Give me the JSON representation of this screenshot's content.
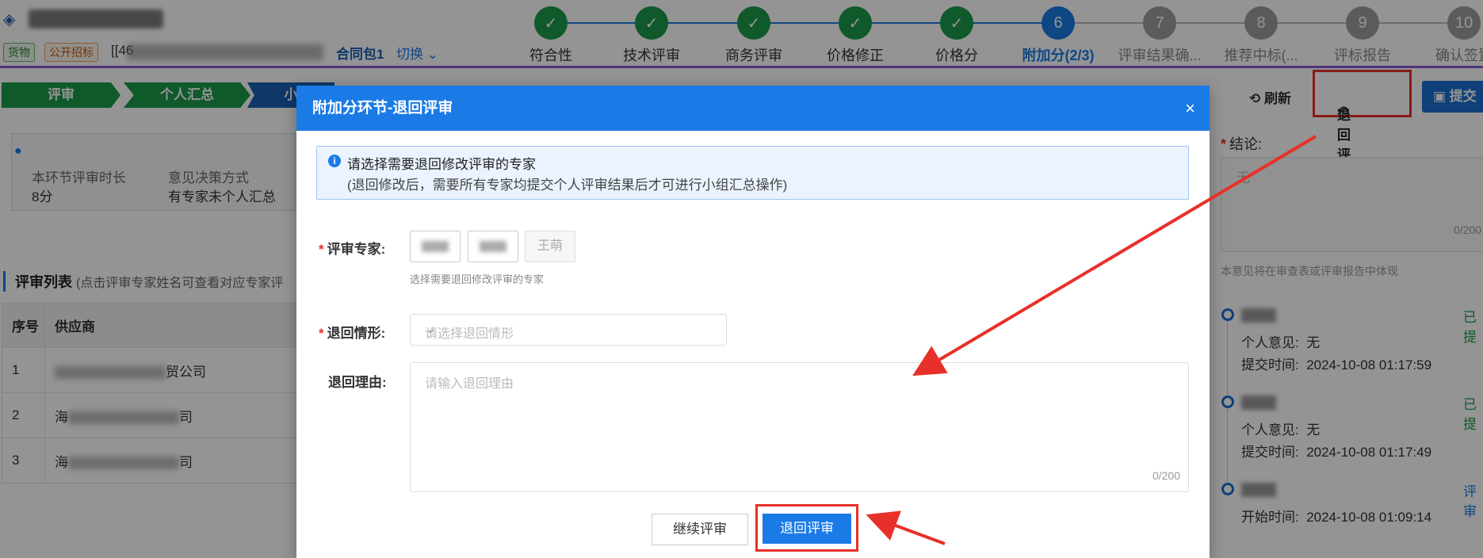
{
  "header": {
    "project_code_prefix": "[[46",
    "tag_goods": "货物",
    "tag_bid": "公开招标",
    "package": "合同包1",
    "switch": "切换"
  },
  "steps": [
    {
      "num": "1",
      "label": "符合性",
      "state": "done"
    },
    {
      "num": "2",
      "label": "技术评审",
      "state": "done"
    },
    {
      "num": "3",
      "label": "商务评审",
      "state": "done"
    },
    {
      "num": "4",
      "label": "价格修正",
      "state": "done"
    },
    {
      "num": "5",
      "label": "价格分",
      "state": "done"
    },
    {
      "num": "6",
      "label": "附加分(2/3)",
      "state": "current"
    },
    {
      "num": "7",
      "label": "评审结果确...",
      "state": "todo"
    },
    {
      "num": "8",
      "label": "推荐中标(...",
      "state": "todo"
    },
    {
      "num": "9",
      "label": "评标报告",
      "state": "todo"
    },
    {
      "num": "10",
      "label": "确认签置",
      "state": "todo"
    }
  ],
  "crumbs": [
    "评审",
    "个人汇总",
    "小"
  ],
  "info": {
    "k1": "本环节评审时长",
    "v1": "8分",
    "k2": "意见决策方式",
    "v2": "有专家未个人汇总"
  },
  "list": {
    "title": "评审列表",
    "subtitle": "(点击评审专家姓名可查看对应专家评",
    "headers": [
      "序号",
      "供应商"
    ],
    "rows": [
      {
        "no": "1",
        "prefix": "",
        "suffix": "贸公司"
      },
      {
        "no": "2",
        "prefix": "海",
        "suffix": "司"
      },
      {
        "no": "3",
        "prefix": "海",
        "suffix": "司"
      }
    ]
  },
  "toolbar": {
    "refresh": "刷新",
    "retreat": "退回评审",
    "submit": "提交"
  },
  "conclusion": {
    "label": "结论:",
    "value": "无",
    "count": "0/200",
    "note": "本意见将在审查表或评审报告中体现"
  },
  "timeline": [
    {
      "status": "已提",
      "line1_k": "个人意见:",
      "line1_v": "无",
      "line2_k": "提交时间:",
      "line2_v": "2024-10-08 01:17:59"
    },
    {
      "status": "已提",
      "line1_k": "个人意见:",
      "line1_v": "无",
      "line2_k": "提交时间:",
      "line2_v": "2024-10-08 01:17:49"
    },
    {
      "status": "评审",
      "line2_k": "开始时间:",
      "line2_v": "2024-10-08 01:09:14"
    }
  ],
  "modal": {
    "title": "附加分环节-退回评审",
    "close": "×",
    "tip_line1": "请选择需要退回修改评审的专家",
    "tip_line2": "(退回修改后，需要所有专家均提交个人评审结果后才可进行小组汇总操作)",
    "expert_label": "评审专家:",
    "experts": [
      "",
      "",
      "王萌"
    ],
    "expert_hint": "选择需要退回修改评审的专家",
    "situation_label": "退回情形:",
    "situation_placeholder": "请选择退回情形",
    "reason_label": "退回理由:",
    "reason_placeholder": "请输入退回理由",
    "reason_count": "0/200",
    "btn_continue": "继续评审",
    "btn_retreat": "退回评审"
  },
  "colors": {
    "accent": "#1a7ae6",
    "done": "#1a9a4a",
    "annotation": "#e8302a"
  }
}
